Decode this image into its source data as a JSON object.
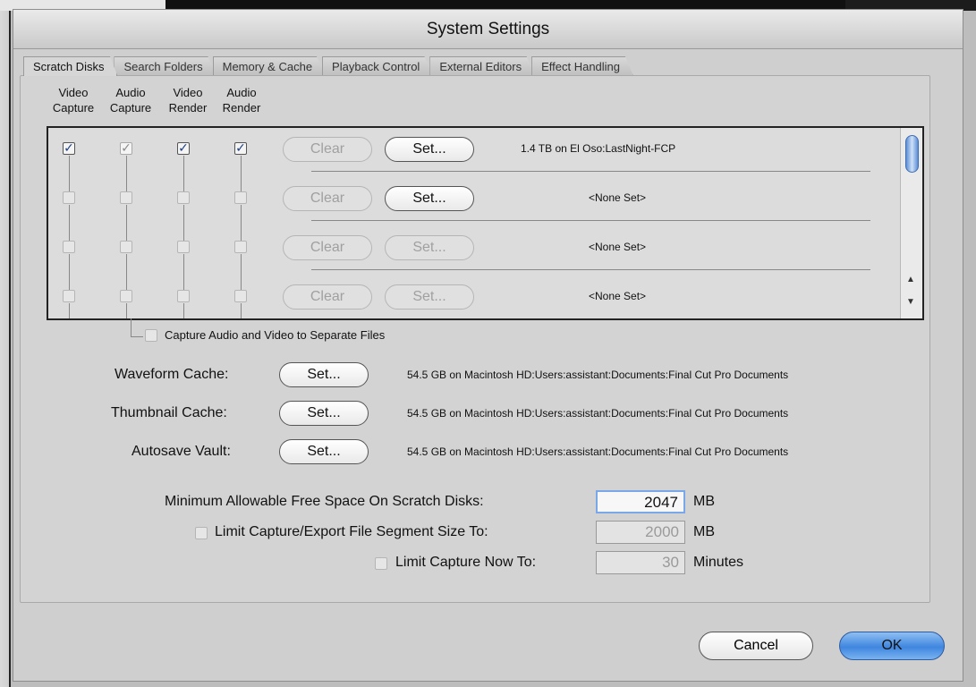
{
  "window": {
    "title": "System Settings"
  },
  "tabs": [
    {
      "label": "Scratch Disks",
      "active": true
    },
    {
      "label": "Search Folders",
      "active": false
    },
    {
      "label": "Memory & Cache",
      "active": false
    },
    {
      "label": "Playback Control",
      "active": false
    },
    {
      "label": "External Editors",
      "active": false
    },
    {
      "label": "Effect Handling",
      "active": false
    }
  ],
  "columns": [
    {
      "line1": "Video",
      "line2": "Capture"
    },
    {
      "line1": "Audio",
      "line2": "Capture"
    },
    {
      "line1": "Video",
      "line2": "Render"
    },
    {
      "line1": "Audio",
      "line2": "Render"
    }
  ],
  "disk_rows": [
    {
      "checks": [
        true,
        true,
        true,
        true
      ],
      "gray_checks": [
        false,
        true,
        false,
        false
      ],
      "clear_label": "Clear",
      "set_label": "Set...",
      "set_enabled": true,
      "info": "1.4 TB on  El Oso:LastNight-FCP"
    },
    {
      "checks": [
        false,
        false,
        false,
        false
      ],
      "gray_checks": [
        false,
        false,
        false,
        false
      ],
      "clear_label": "Clear",
      "set_label": "Set...",
      "set_enabled": true,
      "info": "<None Set>"
    },
    {
      "checks": [
        false,
        false,
        false,
        false
      ],
      "gray_checks": [
        false,
        false,
        false,
        false
      ],
      "clear_label": "Clear",
      "set_label": "Set...",
      "set_enabled": false,
      "info": "<None Set>"
    },
    {
      "checks": [
        false,
        false,
        false,
        false
      ],
      "gray_checks": [
        false,
        false,
        false,
        false
      ],
      "clear_label": "Clear",
      "set_label": "Set...",
      "set_enabled": false,
      "info": "<None Set>"
    }
  ],
  "separate_files": {
    "label": "Capture Audio and Video to Separate Files",
    "checked": false
  },
  "caches": [
    {
      "label": "Waveform Cache:",
      "button": "Set...",
      "info": "54.5 GB on  Macintosh HD:Users:assistant:Documents:Final Cut Pro Documents"
    },
    {
      "label": "Thumbnail Cache:",
      "button": "Set...",
      "info": "54.5 GB on  Macintosh HD:Users:assistant:Documents:Final Cut Pro Documents"
    },
    {
      "label": "Autosave Vault:",
      "button": "Set...",
      "info": "54.5 GB on  Macintosh HD:Users:assistant:Documents:Final Cut Pro Documents"
    }
  ],
  "limits": {
    "min_free": {
      "label": "Minimum Allowable Free Space On Scratch Disks:",
      "value": "2047",
      "unit": "MB"
    },
    "segment": {
      "label": "Limit Capture/Export File Segment Size To:",
      "value": "2000",
      "unit": "MB",
      "checked": false
    },
    "capture_now": {
      "label": "Limit Capture Now To:",
      "value": "30",
      "unit": "Minutes",
      "checked": false
    }
  },
  "footer": {
    "cancel": "Cancel",
    "ok": "OK"
  },
  "icons": {
    "scroll_up": "triangle-up",
    "scroll_down": "triangle-down",
    "checkmark": "check"
  },
  "colors": {
    "accent": "#3f86e0",
    "check": "#1e3f82"
  }
}
